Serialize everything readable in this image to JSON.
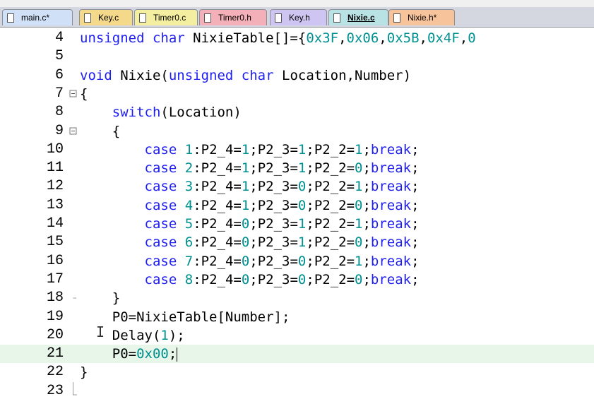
{
  "tabs": [
    {
      "label": "main.c*",
      "color": "#cfe0f7"
    },
    {
      "label": "Key.c",
      "color": "#f5d98a"
    },
    {
      "label": "Timer0.c",
      "color": "#f4eea0"
    },
    {
      "label": "Timer0.h",
      "color": "#f4b0b8"
    },
    {
      "label": "Key.h",
      "color": "#cfc5f2"
    },
    {
      "label": "Nixie.c",
      "color": "#b9e2e4"
    },
    {
      "label": "Nixie.h*",
      "color": "#f7c39b"
    }
  ],
  "active_tab": "Nixie.c",
  "current_line": "21",
  "lines": [
    {
      "num": "4",
      "tokens": [
        [
          "kw",
          "unsigned char"
        ],
        [
          "p",
          " NixieTable[]={"
        ],
        [
          "n",
          "0x3F"
        ],
        [
          "p",
          ","
        ],
        [
          "n",
          "0x06"
        ],
        [
          "p",
          ","
        ],
        [
          "n",
          "0x5B"
        ],
        [
          "p",
          ","
        ],
        [
          "n",
          "0x4F"
        ],
        [
          "p",
          ","
        ],
        [
          "n",
          "0"
        ]
      ]
    },
    {
      "num": "5",
      "tokens": []
    },
    {
      "num": "6",
      "tokens": [
        [
          "kw",
          "void"
        ],
        [
          "p",
          " Nixie("
        ],
        [
          "kw",
          "unsigned char"
        ],
        [
          "p",
          " Location,Number)"
        ]
      ]
    },
    {
      "num": "7",
      "tokens": [
        [
          "p",
          "{"
        ]
      ]
    },
    {
      "num": "8",
      "tokens": [
        [
          "p",
          "    "
        ],
        [
          "kw",
          "switch"
        ],
        [
          "p",
          "(Location)"
        ]
      ]
    },
    {
      "num": "9",
      "tokens": [
        [
          "p",
          "    {"
        ]
      ]
    },
    {
      "num": "10",
      "tokens": [
        [
          "p",
          "        "
        ],
        [
          "kw",
          "case"
        ],
        [
          "p",
          " "
        ],
        [
          "n",
          "1"
        ],
        [
          "p",
          ":P2_4="
        ],
        [
          "n",
          "1"
        ],
        [
          "p",
          ";P2_3="
        ],
        [
          "n",
          "1"
        ],
        [
          "p",
          ";P2_2="
        ],
        [
          "n",
          "1"
        ],
        [
          "p",
          ";"
        ],
        [
          "kw",
          "break"
        ],
        [
          "p",
          ";"
        ]
      ]
    },
    {
      "num": "11",
      "tokens": [
        [
          "p",
          "        "
        ],
        [
          "kw",
          "case"
        ],
        [
          "p",
          " "
        ],
        [
          "n",
          "2"
        ],
        [
          "p",
          ":P2_4="
        ],
        [
          "n",
          "1"
        ],
        [
          "p",
          ";P2_3="
        ],
        [
          "n",
          "1"
        ],
        [
          "p",
          ";P2_2="
        ],
        [
          "n",
          "0"
        ],
        [
          "p",
          ";"
        ],
        [
          "kw",
          "break"
        ],
        [
          "p",
          ";"
        ]
      ]
    },
    {
      "num": "12",
      "tokens": [
        [
          "p",
          "        "
        ],
        [
          "kw",
          "case"
        ],
        [
          "p",
          " "
        ],
        [
          "n",
          "3"
        ],
        [
          "p",
          ":P2_4="
        ],
        [
          "n",
          "1"
        ],
        [
          "p",
          ";P2_3="
        ],
        [
          "n",
          "0"
        ],
        [
          "p",
          ";P2_2="
        ],
        [
          "n",
          "1"
        ],
        [
          "p",
          ";"
        ],
        [
          "kw",
          "break"
        ],
        [
          "p",
          ";"
        ]
      ]
    },
    {
      "num": "13",
      "tokens": [
        [
          "p",
          "        "
        ],
        [
          "kw",
          "case"
        ],
        [
          "p",
          " "
        ],
        [
          "n",
          "4"
        ],
        [
          "p",
          ":P2_4="
        ],
        [
          "n",
          "1"
        ],
        [
          "p",
          ";P2_3="
        ],
        [
          "n",
          "0"
        ],
        [
          "p",
          ";P2_2="
        ],
        [
          "n",
          "0"
        ],
        [
          "p",
          ";"
        ],
        [
          "kw",
          "break"
        ],
        [
          "p",
          ";"
        ]
      ]
    },
    {
      "num": "14",
      "tokens": [
        [
          "p",
          "        "
        ],
        [
          "kw",
          "case"
        ],
        [
          "p",
          " "
        ],
        [
          "n",
          "5"
        ],
        [
          "p",
          ":P2_4="
        ],
        [
          "n",
          "0"
        ],
        [
          "p",
          ";P2_3="
        ],
        [
          "n",
          "1"
        ],
        [
          "p",
          ";P2_2="
        ],
        [
          "n",
          "1"
        ],
        [
          "p",
          ";"
        ],
        [
          "kw",
          "break"
        ],
        [
          "p",
          ";"
        ]
      ]
    },
    {
      "num": "15",
      "tokens": [
        [
          "p",
          "        "
        ],
        [
          "kw",
          "case"
        ],
        [
          "p",
          " "
        ],
        [
          "n",
          "6"
        ],
        [
          "p",
          ":P2_4="
        ],
        [
          "n",
          "0"
        ],
        [
          "p",
          ";P2_3="
        ],
        [
          "n",
          "1"
        ],
        [
          "p",
          ";P2_2="
        ],
        [
          "n",
          "0"
        ],
        [
          "p",
          ";"
        ],
        [
          "kw",
          "break"
        ],
        [
          "p",
          ";"
        ]
      ]
    },
    {
      "num": "16",
      "tokens": [
        [
          "p",
          "        "
        ],
        [
          "kw",
          "case"
        ],
        [
          "p",
          " "
        ],
        [
          "n",
          "7"
        ],
        [
          "p",
          ":P2_4="
        ],
        [
          "n",
          "0"
        ],
        [
          "p",
          ";P2_3="
        ],
        [
          "n",
          "0"
        ],
        [
          "p",
          ";P2_2="
        ],
        [
          "n",
          "1"
        ],
        [
          "p",
          ";"
        ],
        [
          "kw",
          "break"
        ],
        [
          "p",
          ";"
        ]
      ]
    },
    {
      "num": "17",
      "tokens": [
        [
          "p",
          "        "
        ],
        [
          "kw",
          "case"
        ],
        [
          "p",
          " "
        ],
        [
          "n",
          "8"
        ],
        [
          "p",
          ":P2_4="
        ],
        [
          "n",
          "0"
        ],
        [
          "p",
          ";P2_3="
        ],
        [
          "n",
          "0"
        ],
        [
          "p",
          ";P2_2="
        ],
        [
          "n",
          "0"
        ],
        [
          "p",
          ";"
        ],
        [
          "kw",
          "break"
        ],
        [
          "p",
          ";"
        ]
      ]
    },
    {
      "num": "18",
      "tokens": [
        [
          "p",
          "    }"
        ]
      ]
    },
    {
      "num": "19",
      "tokens": [
        [
          "p",
          "    P0=NixieTable[Number];"
        ]
      ]
    },
    {
      "num": "20",
      "tokens": [
        [
          "p",
          "    Delay("
        ],
        [
          "n",
          "1"
        ],
        [
          "p",
          ");"
        ]
      ]
    },
    {
      "num": "21",
      "tokens": [
        [
          "p",
          "    P0="
        ],
        [
          "n",
          "0x00"
        ],
        [
          "p",
          ";"
        ]
      ]
    },
    {
      "num": "22",
      "tokens": [
        [
          "p",
          "}"
        ]
      ]
    },
    {
      "num": "23",
      "tokens": []
    }
  ],
  "colors": {
    "keyword": "#1e1ef0",
    "number": "#009090",
    "current_line_bg": "#e8f6ea"
  },
  "cursor_icon": "i-beam-cursor-icon",
  "ibeam_glyph": "I"
}
